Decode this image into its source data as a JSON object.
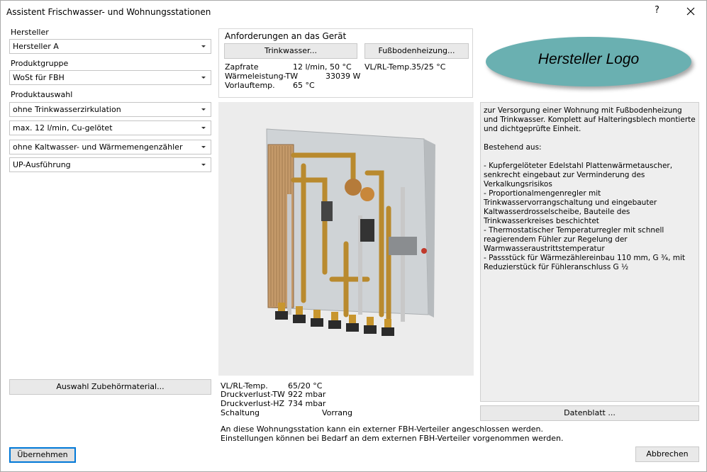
{
  "window": {
    "title": "Assistent Frischwasser- und Wohnungsstationen",
    "help": "?"
  },
  "left": {
    "hersteller_label": "Hersteller",
    "hersteller_value": "Hersteller A",
    "produktgruppe_label": "Produktgruppe",
    "produktgruppe_value": "WoSt für FBH",
    "produktauswahl_label": "Produktauswahl",
    "options": [
      "ohne Trinkwasserzirkulation",
      "max. 12 l/min, Cu-gelötet",
      "ohne Kaltwasser- und Wärmemengenzähler",
      "UP-Ausführung"
    ],
    "zubehoer_button": "Auswahl Zubehörmaterial..."
  },
  "requirements": {
    "title": "Anforderungen an das Gerät",
    "trinkwasser_button": "Trinkwasser...",
    "fbh_button": "Fußbodenheizung...",
    "zapfrate_label": "Zapfrate",
    "zapfrate_value": "12 l/min, 50 °C",
    "waermeleistung_label": "Wärmeleistung-TW",
    "waermeleistung_value": "33039 W",
    "vorlauf_label": "Vorlauftemp.",
    "vorlauf_value": "65 °C",
    "vlrl_label": "VL/RL-Temp.",
    "vlrl_value": "35/25 °C"
  },
  "logo": {
    "text": "Hersteller Logo"
  },
  "description": "zur Versorgung einer Wohnung mit Fußbodenheizung und Trinkwasser. Komplett auf Halteringsblech montierte und dichtgeprüfte Einheit.\n\nBestehend aus:\n\n- Kupfergelöteter Edelstahl Plattenwärmetauscher, senkrecht eingebaut zur Verminderung des Verkalkungsrisikos\n- Proportionalmengenregler mit Trinkwasservorrangschaltung und eingebauter Kaltwasserdrosselscheibe, Bauteile des Trinkwasserkreises beschichtet\n- Thermostatischer Temperaturregler mit schnell reagierendem Fühler zur Regelung der Warmwasseraustrittstemperatur\n- Passstück für Wärmezählereinbau 110 mm, G ¾, mit Reduzierstück für Fühleranschluss G ½",
  "stats": {
    "vlrl_label": "VL/RL-Temp.",
    "vlrl_value": "65/20 °C",
    "dv_tw_label": "Druckverlust-TW",
    "dv_tw_value": "922 mbar",
    "dv_hz_label": "Druckverlust-HZ",
    "dv_hz_value": "734 mbar",
    "schaltung_label": "Schaltung",
    "schaltung_value": "Vorrang"
  },
  "notes": {
    "line1": "An diese Wohnungsstation kann ein externer FBH-Verteiler angeschlossen werden.",
    "line2": "Einstellungen können bei Bedarf an dem externen FBH-Verteiler vorgenommen werden."
  },
  "buttons": {
    "datenblatt": "Datenblatt ...",
    "uebernehmen": "Übernehmen",
    "abbrechen": "Abbrechen"
  },
  "colors": {
    "logo": "#6ab0b1",
    "accent": "#0078d7"
  }
}
